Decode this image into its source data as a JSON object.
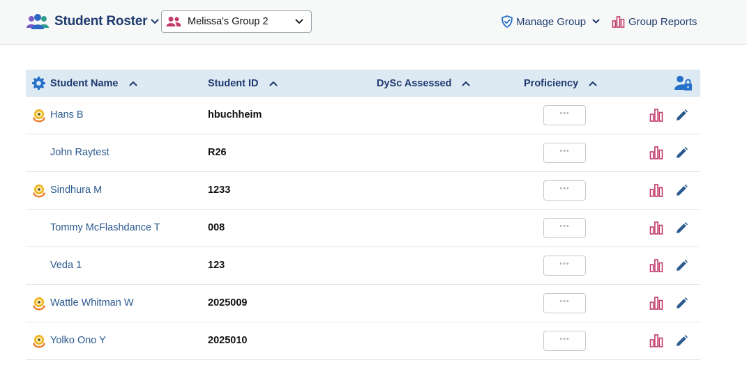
{
  "header": {
    "app_title": "Student Roster",
    "group_selector": {
      "value": "Melissa's Group 2"
    },
    "manage_group_label": "Manage Group",
    "group_reports_label": "Group Reports"
  },
  "table": {
    "columns": {
      "name": "Student Name",
      "id": "Student ID",
      "dysc": "DySc Assessed",
      "proficiency": "Proficiency"
    },
    "rows": [
      {
        "name": "Hans B",
        "id": "hbuchheim",
        "has_badge": true,
        "proficiency": "•••"
      },
      {
        "name": "John Raytest",
        "id": "R26",
        "has_badge": false,
        "proficiency": "•••"
      },
      {
        "name": "Sindhura M",
        "id": "1233",
        "has_badge": true,
        "proficiency": "•••"
      },
      {
        "name": "Tommy McFlashdance T",
        "id": "008",
        "has_badge": false,
        "proficiency": "•••"
      },
      {
        "name": "Veda 1",
        "id": "123",
        "has_badge": false,
        "proficiency": "•••"
      },
      {
        "name": "Wattle Whitman W",
        "id": "2025009",
        "has_badge": true,
        "proficiency": "•••"
      },
      {
        "name": "Yolko Ono Y",
        "id": "2025010",
        "has_badge": true,
        "proficiency": "•••"
      }
    ]
  },
  "icons": {
    "app_logo": "people-group-icon",
    "group": "group-icon",
    "manage_group": "shield-check-icon",
    "group_reports": "bar-chart-icon",
    "settings": "gear-icon",
    "lock_user": "user-lock-icon",
    "student_badge": "medal-icon",
    "row_report": "bar-chart-icon",
    "row_edit": "pencil-icon"
  },
  "colors": {
    "navy": "#1e3a6e",
    "link_blue": "#2b5a8e",
    "accent_blue": "#2670c9",
    "report_pink": "#c2396b",
    "badge_gold": "#f2b51c",
    "badge_orange": "#f07b2b",
    "table_header_bg": "#dde9f3"
  }
}
